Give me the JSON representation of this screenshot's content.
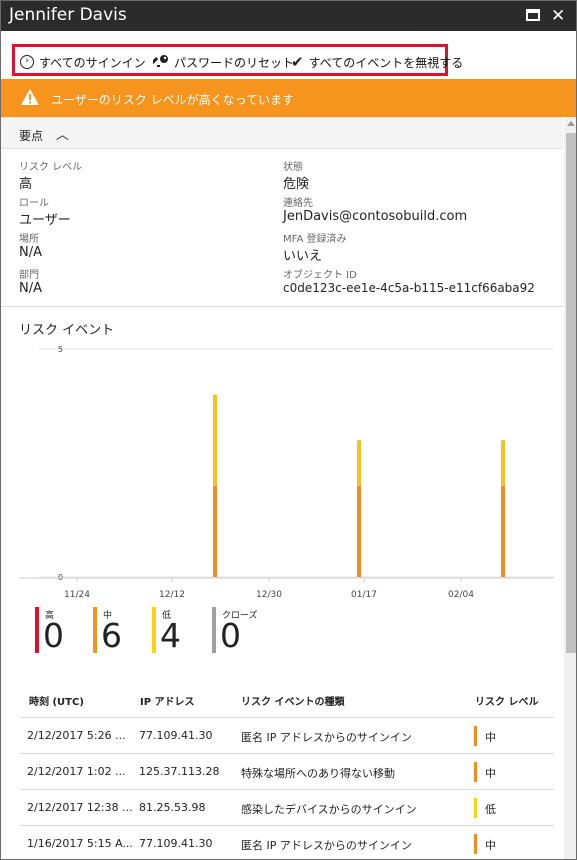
{
  "window": {
    "title": "Jennifer Davis"
  },
  "commands": {
    "all_signins": "すべてのサインイン",
    "reset_password": "パスワードのリセット",
    "dismiss_events": "すべてのイベントを無視する"
  },
  "banner": {
    "text": "ユーザーのリスク レベルが高くなっています",
    "color": "#f7941d"
  },
  "essentials": {
    "title": "要点",
    "left": [
      {
        "label": "リスク レベル",
        "value": "高"
      },
      {
        "label": "ロール",
        "value": "ユーザー"
      },
      {
        "label": "場所",
        "value": "N/A"
      },
      {
        "label": "部門",
        "value": "N/A"
      }
    ],
    "right": [
      {
        "label": "状態",
        "value": "危険"
      },
      {
        "label": "連絡先",
        "value": "JenDavis@contosobuild.com"
      },
      {
        "label": "MFA 登録済み",
        "value": "いいえ"
      },
      {
        "label": "オブジェクト ID",
        "value": "c0de123c-ee1e-4c5a-b115-e11cf66aba92"
      }
    ]
  },
  "risk_events": {
    "title": "リスク イベント",
    "counters": [
      {
        "label": "高",
        "value": "0",
        "color": "#e0102e"
      },
      {
        "label": "中",
        "value": "6",
        "color": "#f7941d"
      },
      {
        "label": "低",
        "value": "4",
        "color": "#fcd116"
      },
      {
        "label": "クローズ",
        "value": "0",
        "color": "#a0a0a0"
      }
    ]
  },
  "chart_data": {
    "type": "bar",
    "stacked": true,
    "x_ticks": [
      "11/24",
      "12/12",
      "12/30",
      "01/17",
      "02/04"
    ],
    "ylim": [
      0,
      5
    ],
    "y_ticks": [
      "0",
      "5"
    ],
    "grid": true,
    "categories": [
      "12/19/2016",
      "1/16/2017",
      "2/12/2017"
    ],
    "series": [
      {
        "name": "中",
        "color": "#f28c1e",
        "values": [
          2,
          2,
          2
        ]
      },
      {
        "name": "低",
        "color": "#f8c21e",
        "values": [
          2,
          1,
          1
        ]
      }
    ]
  },
  "table": {
    "headers": [
      "時刻 (UTC)",
      "IP アドレス",
      "リスク イベントの種類",
      "リスク レベル"
    ],
    "rows": [
      {
        "time": "2/12/2017 5:26 ...",
        "ip": "77.109.41.30",
        "type": "匿名 IP アドレスからのサインイン",
        "level": "中",
        "color": "#f28c1e"
      },
      {
        "time": "2/12/2017 1:02 ...",
        "ip": "125.37.113.28",
        "type": "特殊な場所へのあり得ない移動",
        "level": "中",
        "color": "#f28c1e"
      },
      {
        "time": "2/12/2017 12:38 ...",
        "ip": "81.25.53.98",
        "type": "感染したデバイスからのサインイン",
        "level": "低",
        "color": "#fcd116"
      },
      {
        "time": "1/16/2017 5:15 A...",
        "ip": "77.109.41.30",
        "type": "匿名 IP アドレスからのサインイン",
        "level": "中",
        "color": "#f28c1e"
      }
    ]
  }
}
